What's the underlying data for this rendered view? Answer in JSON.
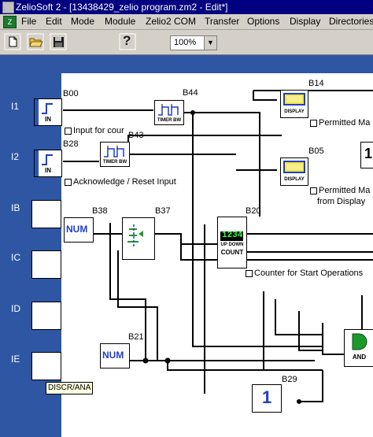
{
  "title": "ZelioSoft 2 - [13438429_zelio program.zm2 - Edit*]",
  "menu": [
    "File",
    "Edit",
    "Mode",
    "Module",
    "Zelio2 COM",
    "Transfer",
    "Options",
    "Display",
    "Directories"
  ],
  "toolbar": {
    "zoom": "100%",
    "zoom_arrow": "▼",
    "help": "?"
  },
  "inputs": [
    {
      "label": "I1"
    },
    {
      "label": "I2"
    },
    {
      "label": "IB"
    },
    {
      "label": "IC"
    },
    {
      "label": "ID"
    },
    {
      "label": "IE"
    }
  ],
  "tooltip": "DISCR/ANA",
  "blocks": {
    "b00": {
      "id": "B00",
      "caption": "IN",
      "comment": "Input for cour"
    },
    "b28": {
      "id": "B28",
      "caption": "IN",
      "comment": "Acknowledge / Reset Input"
    },
    "b44": {
      "id": "B44",
      "caption": "TIMER BW"
    },
    "b43": {
      "id": "B43",
      "caption": "TIMER BW"
    },
    "b38": {
      "id": "B38",
      "caption": "NUM"
    },
    "b37": {
      "id": "B37"
    },
    "b20": {
      "id": "B20",
      "value": "1234",
      "caption1": "UP DOWN",
      "caption2": "COUNT",
      "comment": "Counter for Start Operations"
    },
    "b14": {
      "id": "B14",
      "caption": "DISPLAY",
      "comment": "Permitted Ma"
    },
    "b05": {
      "id": "B05",
      "caption": "DISPLAY",
      "comment1": "Permitted Ma",
      "comment2": "from Display"
    },
    "b21": {
      "id": "B21",
      "caption": "NUM"
    },
    "b29": {
      "id": "B29",
      "value": "1"
    },
    "and": {
      "caption": "AND"
    }
  },
  "partial_block_value": "1",
  "colors": {
    "panel": "#2e56a3",
    "titlebar": "#000080",
    "num_text": "#1f3fc2",
    "green": "#1b9a2b"
  }
}
